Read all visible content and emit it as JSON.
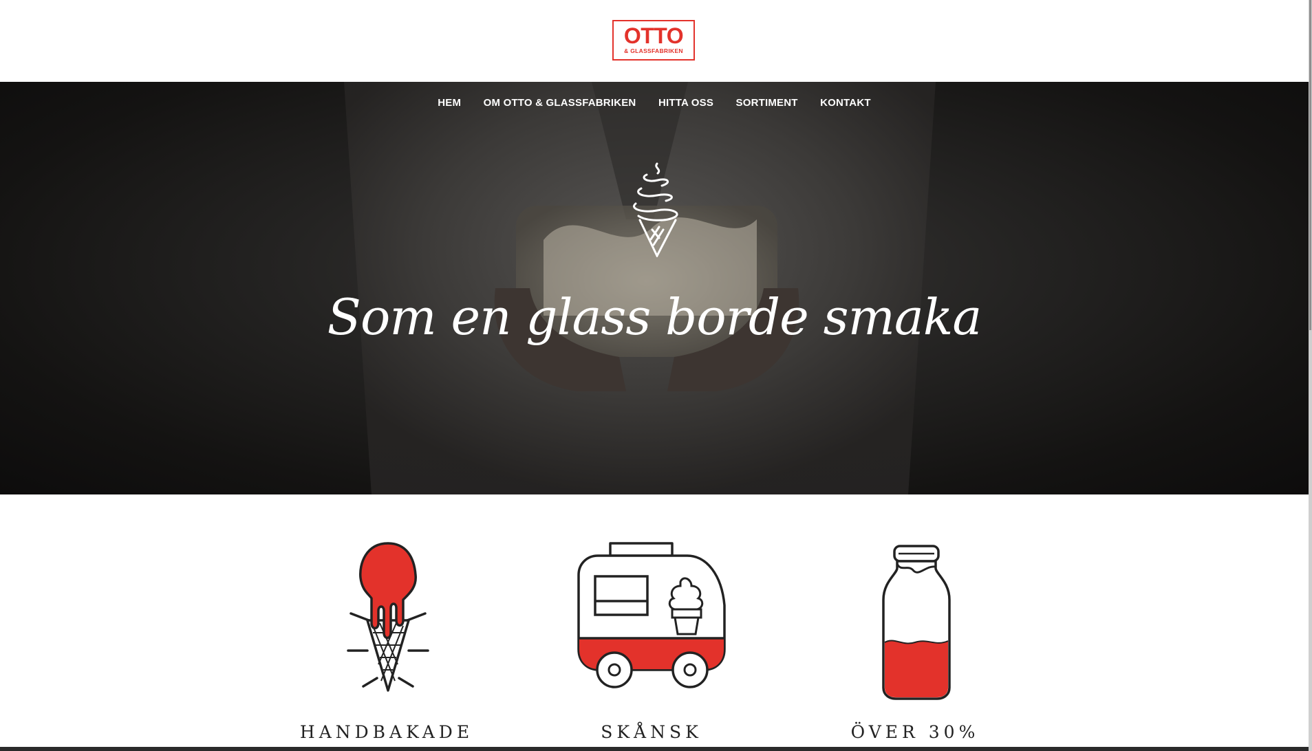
{
  "brand": {
    "logo_main": "OTTO",
    "logo_sub": "& GLASSFABRIKEN",
    "accent_color": "#e3322b"
  },
  "nav": {
    "items": [
      {
        "label": "HEM"
      },
      {
        "label": "OM OTTO & GLASSFABRIKEN"
      },
      {
        "label": "HITTA OSS"
      },
      {
        "label": "SORTIMENT"
      },
      {
        "label": "KONTAKT"
      }
    ]
  },
  "hero": {
    "tagline": "Som en glass borde smaka",
    "icon": "soft-serve-cone-icon"
  },
  "features": [
    {
      "title": "HANDBAKADE",
      "icon": "ice-cream-cone-icon"
    },
    {
      "title": "SKÅNSK",
      "icon": "ice-cream-truck-icon"
    },
    {
      "title": "ÖVER 30%",
      "icon": "milk-bottle-icon"
    }
  ]
}
